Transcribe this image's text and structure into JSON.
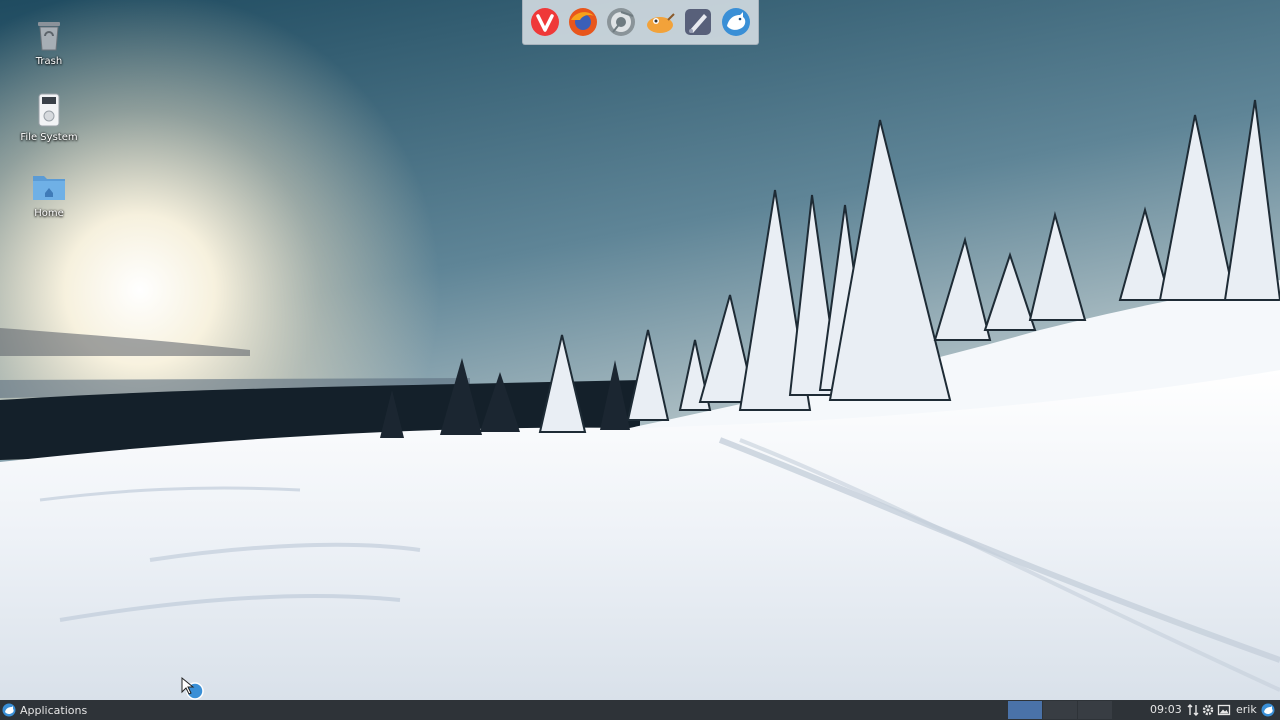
{
  "desktop": {
    "icons": [
      {
        "label": "Trash",
        "icon": "trash-icon"
      },
      {
        "label": "File System",
        "icon": "drive-icon"
      },
      {
        "label": "Home",
        "icon": "folder-home-icon"
      }
    ]
  },
  "dock": {
    "items": [
      {
        "icon": "vivaldi-icon",
        "color": "#ef3939"
      },
      {
        "icon": "firefox-icon",
        "color": "#e8561c"
      },
      {
        "icon": "chromium-icon",
        "color": "#6f7b80"
      },
      {
        "icon": "gimp-icon",
        "color": "#f2a23a"
      },
      {
        "icon": "inkscape-icon",
        "color": "#58607a"
      },
      {
        "icon": "mascot-icon",
        "color": "#3a8fd6"
      }
    ]
  },
  "taskbar": {
    "applications_label": "Applications",
    "clock": "09:03",
    "user": "erik",
    "active_workspace_color": "#4a72a8"
  },
  "colors": {
    "sky_top": "#2b5468",
    "sky_sun": "#fdf6e3",
    "snow": "#f4f7fb",
    "taskbar": "#2e3338"
  }
}
